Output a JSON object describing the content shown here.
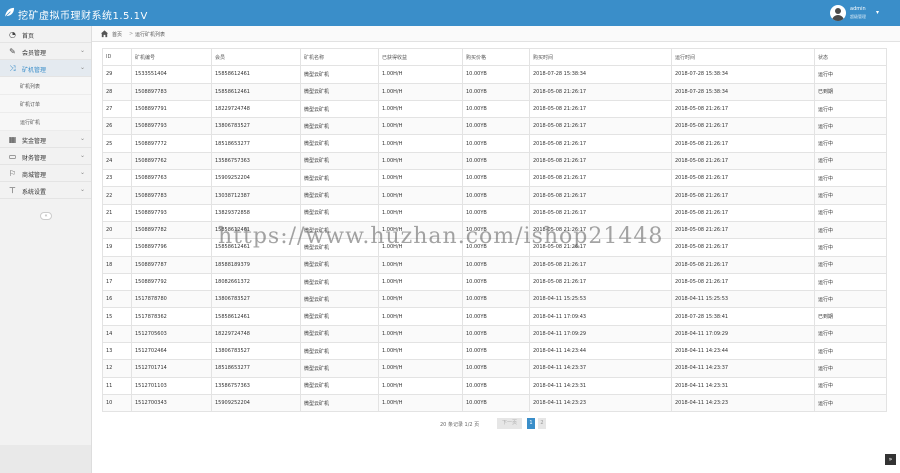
{
  "app": {
    "title": "挖矿虚拟币理财系统1.5.1V",
    "brand_color": "#3a8ec9"
  },
  "user": {
    "name": "admin",
    "role": "超级管理"
  },
  "sidebar": {
    "items": [
      {
        "icon": "dashboard-icon",
        "label": "首页"
      },
      {
        "icon": "edit-icon",
        "label": "会员管理"
      },
      {
        "icon": "shuffle-icon",
        "label": "矿机管理"
      },
      {
        "icon": "calendar-icon",
        "label": "奖金管理"
      },
      {
        "icon": "card-icon",
        "label": "财务管理"
      },
      {
        "icon": "flag-icon",
        "label": "商城管理"
      },
      {
        "icon": "settings-icon",
        "label": "系统设置"
      }
    ],
    "sub_items": [
      "矿机列表",
      "矿机订单",
      "运行矿机"
    ]
  },
  "breadcrumb": {
    "home": "首页",
    "separator": ">",
    "current": "运行矿机列表"
  },
  "table": {
    "headers": [
      "ID",
      "矿机编号",
      "会员",
      "矿机名称",
      "已获得收益",
      "购买价格",
      "购买时间",
      "运行时间",
      "状态"
    ],
    "rows": [
      [
        "29",
        "1533551404",
        "15858612461",
        "微型云矿机",
        "1.00H/H",
        "10.00YB",
        "2018-07-28 15:38:34",
        "2018-07-28 15:38:34",
        "运行中"
      ],
      [
        "28",
        "1508897783",
        "15858612461",
        "微型云矿机",
        "1.00H/H",
        "10.00YB",
        "2018-05-08 21:26:17",
        "2018-07-28 15:38:34",
        "已到期"
      ],
      [
        "27",
        "1508897791",
        "18229724748",
        "微型云矿机",
        "1.00H/H",
        "10.00YB",
        "2018-05-08 21:26:17",
        "2018-05-08 21:26:17",
        "运行中"
      ],
      [
        "26",
        "1508897793",
        "13806783527",
        "微型云矿机",
        "1.00H/H",
        "10.00YB",
        "2018-05-08 21:26:17",
        "2018-05-08 21:26:17",
        "运行中"
      ],
      [
        "25",
        "1508897772",
        "18518653277",
        "微型云矿机",
        "1.00H/H",
        "10.00YB",
        "2018-05-08 21:26:17",
        "2018-05-08 21:26:17",
        "运行中"
      ],
      [
        "24",
        "1508897762",
        "13586757363",
        "微型云矿机",
        "1.00H/H",
        "10.00YB",
        "2018-05-08 21:26:17",
        "2018-05-08 21:26:17",
        "运行中"
      ],
      [
        "23",
        "1508897763",
        "15909252204",
        "微型云矿机",
        "1.00H/H",
        "10.00YB",
        "2018-05-08 21:26:17",
        "2018-05-08 21:26:17",
        "运行中"
      ],
      [
        "22",
        "1508897783",
        "13038712387",
        "微型云矿机",
        "1.00H/H",
        "10.00YB",
        "2018-05-08 21:26:17",
        "2018-05-08 21:26:17",
        "运行中"
      ],
      [
        "21",
        "1508897793",
        "13829372858",
        "微型云矿机",
        "1.00H/H",
        "10.00YB",
        "2018-05-08 21:26:17",
        "2018-05-08 21:26:17",
        "运行中"
      ],
      [
        "20",
        "1508897782",
        "15858612461",
        "微型云矿机",
        "1.00H/H",
        "10.00YB",
        "2018-05-08 21:26:17",
        "2018-05-08 21:26:17",
        "运行中"
      ],
      [
        "19",
        "1508897796",
        "15858612461",
        "微型云矿机",
        "1.00H/H",
        "10.00YB",
        "2018-05-08 21:26:17",
        "2018-05-08 21:26:17",
        "运行中"
      ],
      [
        "18",
        "1508897787",
        "18588189379",
        "微型云矿机",
        "1.00H/H",
        "10.00YB",
        "2018-05-08 21:26:17",
        "2018-05-08 21:26:17",
        "运行中"
      ],
      [
        "17",
        "1508897792",
        "18082661372",
        "微型云矿机",
        "1.00H/H",
        "10.00YB",
        "2018-05-08 21:26:17",
        "2018-05-08 21:26:17",
        "运行中"
      ],
      [
        "16",
        "1517878780",
        "13806783527",
        "微型云矿机",
        "1.00H/H",
        "10.00YB",
        "2018-04-11 15:25:53",
        "2018-04-11 15:25:53",
        "运行中"
      ],
      [
        "15",
        "1517878362",
        "15858612461",
        "微型云矿机",
        "1.00H/H",
        "10.00YB",
        "2018-04-11 17:09:43",
        "2018-07-28 15:38:41",
        "已到期"
      ],
      [
        "14",
        "1512705603",
        "18229724748",
        "微型云矿机",
        "1.00H/H",
        "10.00YB",
        "2018-04-11 17:09:29",
        "2018-04-11 17:09:29",
        "运行中"
      ],
      [
        "13",
        "1512702464",
        "13806783527",
        "微型云矿机",
        "1.00H/H",
        "10.00YB",
        "2018-04-11 14:23:44",
        "2018-04-11 14:23:44",
        "运行中"
      ],
      [
        "12",
        "1512701714",
        "18518653277",
        "微型云矿机",
        "1.00H/H",
        "10.00YB",
        "2018-04-11 14:23:37",
        "2018-04-11 14:23:37",
        "运行中"
      ],
      [
        "11",
        "1512701103",
        "13586757363",
        "微型云矿机",
        "1.00H/H",
        "10.00YB",
        "2018-04-11 14:23:31",
        "2018-04-11 14:23:31",
        "运行中"
      ],
      [
        "10",
        "1512700343",
        "15909252204",
        "微型云矿机",
        "1.00H/H",
        "10.00YB",
        "2018-04-11 14:23:23",
        "2018-04-11 14:23:23",
        "运行中"
      ]
    ]
  },
  "pagination": {
    "info": "20 条记录 1/2 页",
    "prev": "下一页",
    "page1": "1",
    "page2": "2"
  },
  "watermark": "https://www.huzhan.com/ishop21448"
}
